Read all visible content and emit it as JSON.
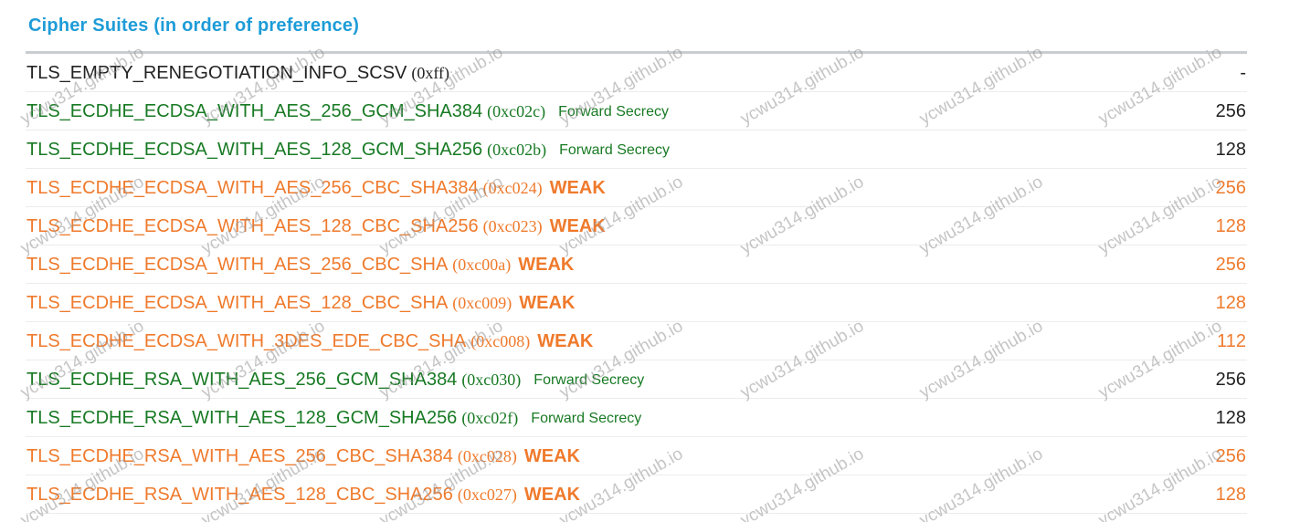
{
  "section": {
    "title": "Cipher Suites (in order of preference)"
  },
  "labels": {
    "forward_secrecy": "Forward Secrecy",
    "weak": "WEAK"
  },
  "colors": {
    "title": "#1e9cd7",
    "default": "#222222",
    "good": "#187a24",
    "weak": "#ef7a2c"
  },
  "watermark": "ycwu314.github.io",
  "cipher_suites": [
    {
      "name": "TLS_EMPTY_RENEGOTIATION_INFO_SCSV",
      "code": "(0xff)",
      "status": "none",
      "bits": "-"
    },
    {
      "name": "TLS_ECDHE_ECDSA_WITH_AES_256_GCM_SHA384",
      "code": "(0xc02c)",
      "status": "forward_secrecy",
      "bits": "256"
    },
    {
      "name": "TLS_ECDHE_ECDSA_WITH_AES_128_GCM_SHA256",
      "code": "(0xc02b)",
      "status": "forward_secrecy",
      "bits": "128"
    },
    {
      "name": "TLS_ECDHE_ECDSA_WITH_AES_256_CBC_SHA384",
      "code": "(0xc024)",
      "status": "weak",
      "bits": "256"
    },
    {
      "name": "TLS_ECDHE_ECDSA_WITH_AES_128_CBC_SHA256",
      "code": "(0xc023)",
      "status": "weak",
      "bits": "128"
    },
    {
      "name": "TLS_ECDHE_ECDSA_WITH_AES_256_CBC_SHA",
      "code": "(0xc00a)",
      "status": "weak",
      "bits": "256"
    },
    {
      "name": "TLS_ECDHE_ECDSA_WITH_AES_128_CBC_SHA",
      "code": "(0xc009)",
      "status": "weak",
      "bits": "128"
    },
    {
      "name": "TLS_ECDHE_ECDSA_WITH_3DES_EDE_CBC_SHA",
      "code": "(0xc008)",
      "status": "weak",
      "bits": "112"
    },
    {
      "name": "TLS_ECDHE_RSA_WITH_AES_256_GCM_SHA384",
      "code": "(0xc030)",
      "status": "forward_secrecy",
      "bits": "256"
    },
    {
      "name": "TLS_ECDHE_RSA_WITH_AES_128_GCM_SHA256",
      "code": "(0xc02f)",
      "status": "forward_secrecy",
      "bits": "128"
    },
    {
      "name": "TLS_ECDHE_RSA_WITH_AES_256_CBC_SHA384",
      "code": "(0xc028)",
      "status": "weak",
      "bits": "256"
    },
    {
      "name": "TLS_ECDHE_RSA_WITH_AES_128_CBC_SHA256",
      "code": "(0xc027)",
      "status": "weak",
      "bits": "128"
    }
  ]
}
